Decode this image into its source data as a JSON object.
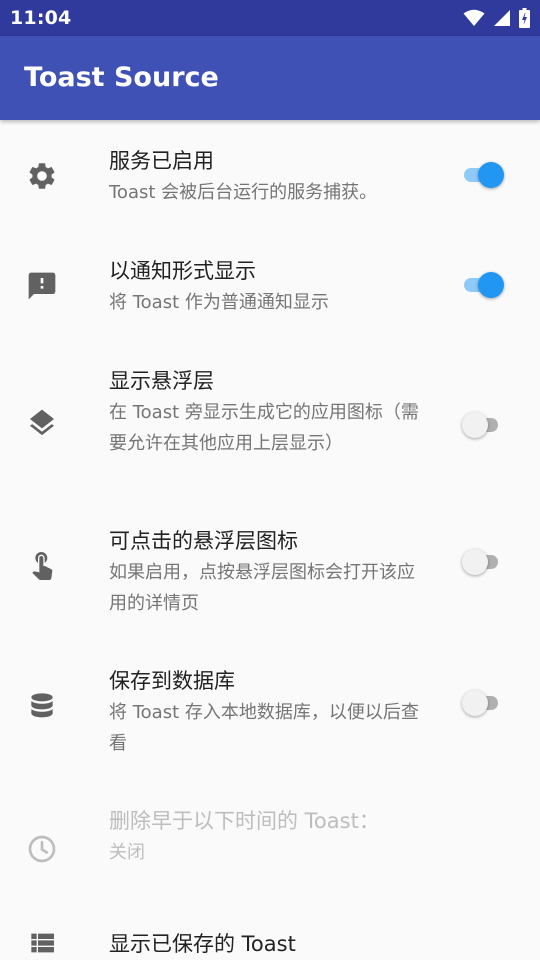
{
  "status_bar": {
    "time": "11:04",
    "icons": [
      "wifi-icon",
      "signal-icon",
      "battery-icon"
    ]
  },
  "app_bar": {
    "title": "Toast Source"
  },
  "colors": {
    "status_bar": "#2f3a9c",
    "app_bar": "#3f51b5",
    "accent": "#2196f3",
    "background": "#fafafa"
  },
  "settings": [
    {
      "icon": "gear-icon",
      "title": "服务已启用",
      "summary": "Toast 会被后台运行的服务捕获。",
      "switch": "on"
    },
    {
      "icon": "notification-alert-icon",
      "title": "以通知形式显示",
      "summary": "将 Toast 作为普通通知显示",
      "switch": "on"
    },
    {
      "icon": "layers-icon",
      "title": "显示悬浮层",
      "summary": "在 Toast 旁显示生成它的应用图标（需要允许在其他应用上层显示）",
      "switch": "off"
    },
    {
      "icon": "touch-icon",
      "title": "可点击的悬浮层图标",
      "summary": "如果启用，点按悬浮层图标会打开该应用的详情页",
      "switch": "off"
    },
    {
      "icon": "database-icon",
      "title": "保存到数据库",
      "summary": "将 Toast 存入本地数据库，以便以后查看",
      "switch": "off"
    },
    {
      "icon": "clock-icon",
      "title": "删除早于以下时间的 Toast：",
      "summary": "关闭",
      "disabled": true
    },
    {
      "icon": "list-icon",
      "title": "显示已保存的 Toast"
    }
  ]
}
